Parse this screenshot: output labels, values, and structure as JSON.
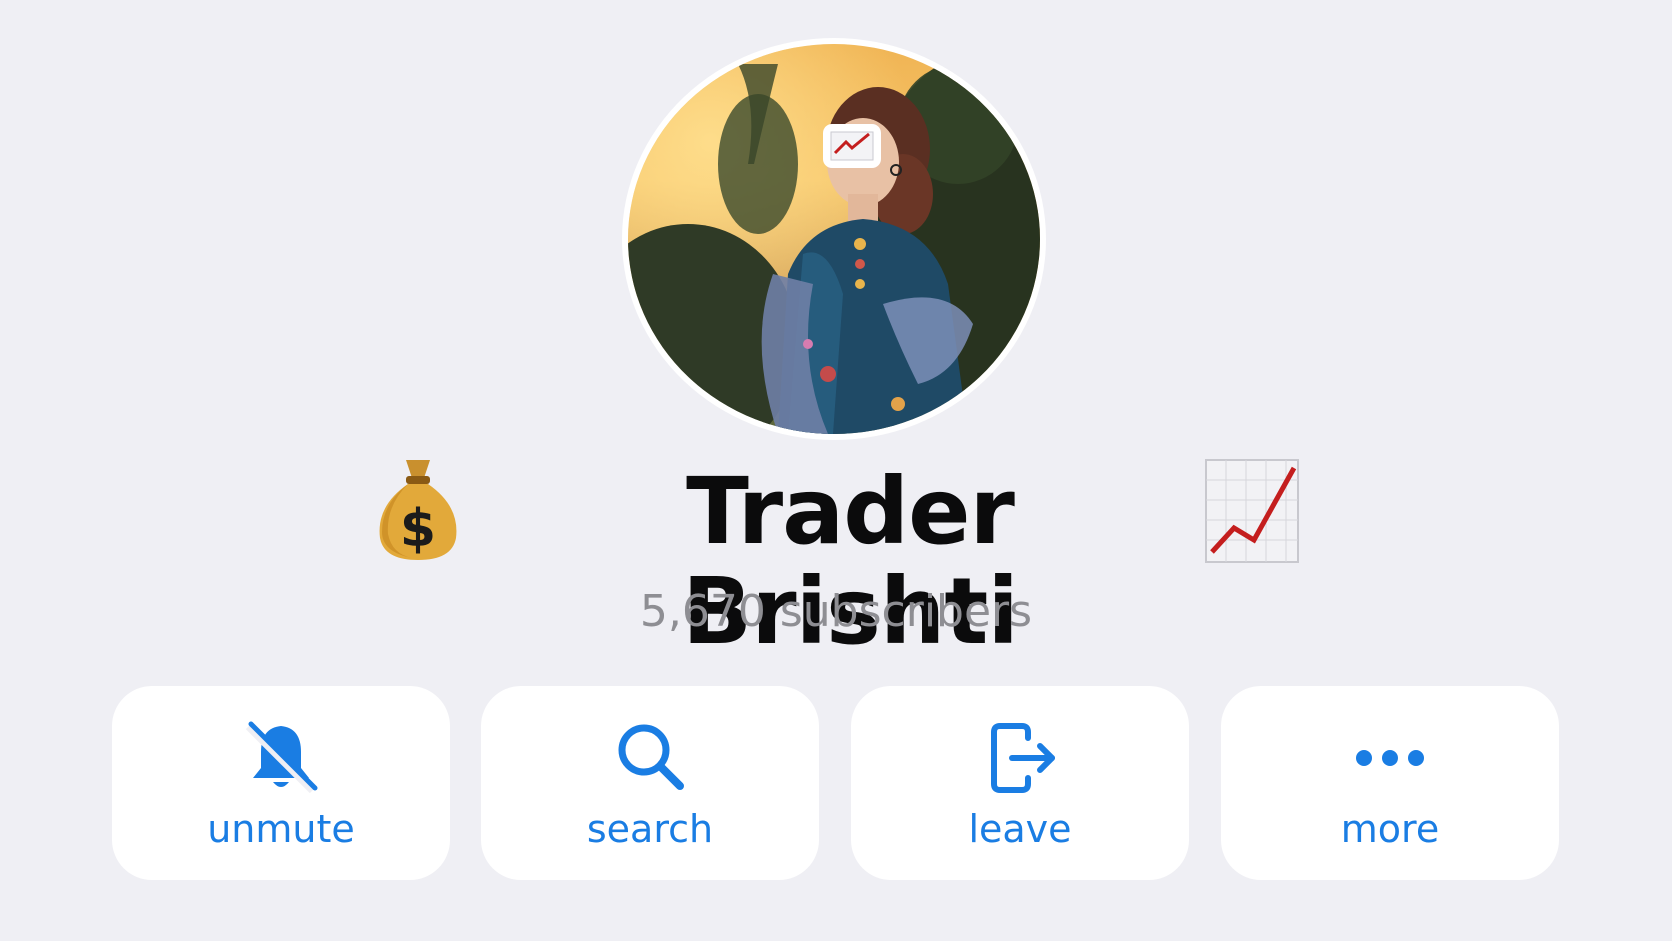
{
  "channel": {
    "title": "Trader Brishti",
    "title_prefix_icon": "money-bag-icon",
    "title_suffix_icon": "chart-increasing-icon",
    "subscribers": "5,670 subscribers"
  },
  "avatar": {
    "badge_icon": "chart-increasing-icon"
  },
  "actions": [
    {
      "label": "unmute",
      "icon": "bell-slash-icon"
    },
    {
      "label": "search",
      "icon": "search-icon"
    },
    {
      "label": "leave",
      "icon": "leave-icon"
    },
    {
      "label": "more",
      "icon": "more-dots-icon"
    }
  ],
  "colors": {
    "background": "#efeff4",
    "accent": "#1a7de3",
    "title": "#0b0b0c",
    "secondary_text": "#8e8e93"
  }
}
